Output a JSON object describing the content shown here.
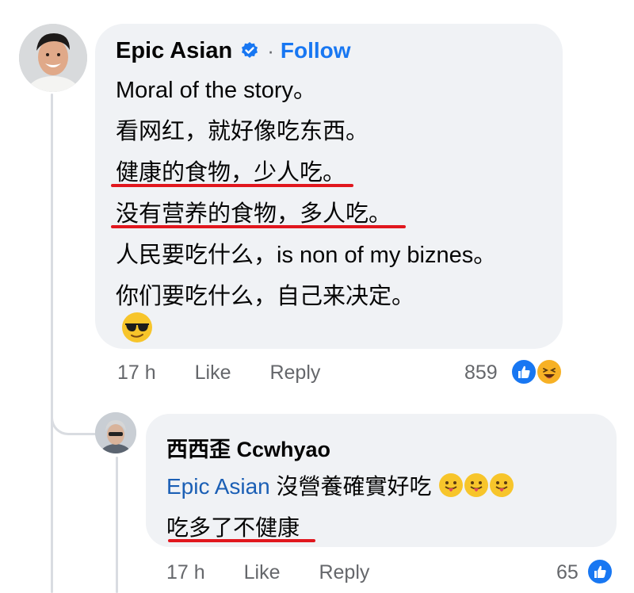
{
  "comment": {
    "author": "Epic Asian",
    "separator": "·",
    "follow_label": "Follow",
    "lines": [
      "Moral of the story。",
      "看网红，就好像吃东西。",
      "健康的食物，少人吃。",
      "没有营养的食物，多人吃。",
      "人民要吃什么，is non of my biznes。",
      "你们要吃什么，自己来决定。"
    ],
    "time": "17 h",
    "like_label": "Like",
    "reply_label": "Reply",
    "reaction_count": "859"
  },
  "reply": {
    "author": "西西歪 Ccwhyao",
    "mention": "Epic Asian",
    "line1_text": " 沒營養確實好吃",
    "line2_text": "吃多了不健康",
    "time": "17 h",
    "like_label": "Like",
    "reply_label": "Reply",
    "reaction_count": "65"
  },
  "colors": {
    "bubble": "#f0f2f5",
    "link_blue": "#1877f2",
    "underline_red": "#e1171e",
    "meta_gray": "#65676b"
  },
  "icons": {
    "verified": "verified-badge-icon",
    "sunglasses": "sunglasses-emoji",
    "like": "thumbs-up-icon",
    "haha": "haha-face-icon",
    "tongue": "tongue-out-emoji"
  }
}
